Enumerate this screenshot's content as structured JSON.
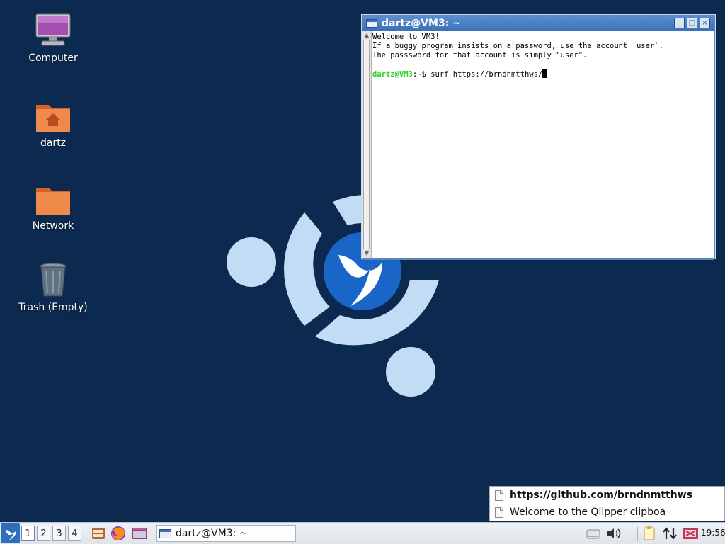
{
  "desktop": {
    "icons": [
      {
        "label": "Computer",
        "icon": "monitor-icon"
      },
      {
        "label": "dartz",
        "icon": "home-folder-icon"
      },
      {
        "label": "Network",
        "icon": "network-folder-icon"
      },
      {
        "label": "Trash (Empty)",
        "icon": "trash-icon"
      }
    ]
  },
  "terminal": {
    "title": "dartz@VM3: ~",
    "lines": [
      "Welcome to VM3!",
      "If a buggy program insists on a password, use the account `user`.",
      "The passsword for that account is simply \"user\"."
    ],
    "prompt_user": "dartz@VM3",
    "prompt_rest": ":~$ ",
    "command": "surf https://brndnmtthws/",
    "buttons": {
      "minimize": "_",
      "maximize": "□",
      "close": "×"
    }
  },
  "clipboard": {
    "items": [
      {
        "text": "https://github.com/brndnmtthws",
        "bold": true
      },
      {
        "text": "Welcome to the Qlipper clipboa",
        "bold": false
      }
    ]
  },
  "taskbar": {
    "workspaces": [
      "1",
      "2",
      "3",
      "4"
    ],
    "active_workspace": "1",
    "task_label": "dartz@VM3: ~",
    "clock": "19:56"
  },
  "colors": {
    "wallpaper": "#0c2a4f",
    "logo_light": "#c3dcf5",
    "logo_blue": "#1a66c8",
    "titlebar": "#3b70b8",
    "prompt": "#2bd32b"
  }
}
